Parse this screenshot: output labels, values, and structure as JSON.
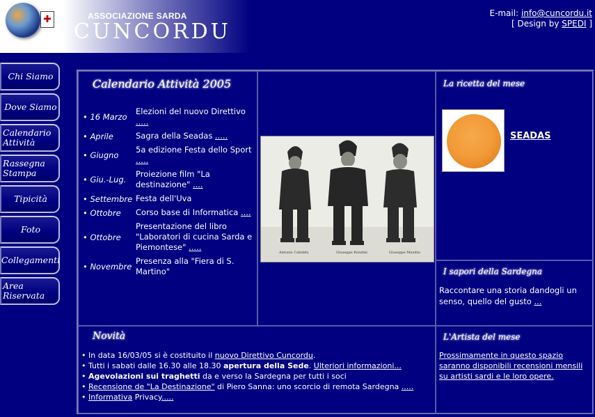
{
  "header": {
    "association": "ASSOCIAZIONE SARDA",
    "brand": "CUNCORDU",
    "email_label": "E-mail:",
    "email": "info@cuncordu.it",
    "design_prefix": "[ Design by",
    "design_link": "SPEDI",
    "design_suffix": "]"
  },
  "nav": {
    "items": [
      {
        "label": "Chi Siamo"
      },
      {
        "label": "Dove Siamo"
      },
      {
        "label": "Calendario Attività"
      },
      {
        "label": "Rassegna Stampa"
      },
      {
        "label": "Tipicità"
      },
      {
        "label": "Foto"
      },
      {
        "label": "Collegamenti"
      },
      {
        "label": "Area Riservata"
      }
    ]
  },
  "calendario": {
    "title": "Calendario Attività  2005",
    "events": [
      {
        "date": "• 16 Marzo",
        "text": "Elezioni del nuovo Direttivo",
        "more": "....."
      },
      {
        "date": "• Aprile",
        "text": "Sagra della Seadas",
        "more": "....."
      },
      {
        "date": "• Giugno",
        "text": "5a edizione Festa dello Sport",
        "more": "....."
      },
      {
        "date": "• Giu.-Lug.",
        "text": "Proiezione film \"La destinazione\"",
        "more": "...."
      },
      {
        "date": "• Settembre",
        "text": "Festa dell'Uva",
        "more": ""
      },
      {
        "date": "• Ottobre",
        "text": "Corso base di Informatica",
        "more": "...."
      },
      {
        "date": "• Ottobre",
        "text": "Presentazione del libro \"Laboratori di cucina Sarda e Piemontese\"",
        "more": "....."
      },
      {
        "date": "• Novembre",
        "text": "Presenza alla \"Fiera di S. Martino\"",
        "more": ""
      }
    ]
  },
  "photo": {
    "captions": [
      "Antonio Cabiddu",
      "Giuseppe Rondini",
      "Giuseppe Musittu"
    ]
  },
  "ricetta": {
    "title": "La ricetta del mese",
    "dish": "SEADAS"
  },
  "sapori": {
    "title": "I sapori della Sardegna",
    "text": "Raccontare una storia dandogli un senso, quello del gusto",
    "more": "..."
  },
  "novita": {
    "title": "Novità",
    "items": {
      "item1_pre": "• In data 16/03/05 si è costituito il ",
      "item1_link": "nuovo Direttivo Cuncordu",
      "item1_post": ".",
      "item2_pre": "• Tutti i sabati dalle 16.30 alle 18.30 ",
      "item2_bold": "apertura della Sede",
      "item2_mid": ". ",
      "item2_link": "Ulteriori informazioni...",
      "item3_pre": "• ",
      "item3_bold": "Agevolazioni sui traghetti",
      "item3_post": " da e verso la Sardegna per tutti i soci",
      "item4_pre": "• ",
      "item4_link": "Recensione de \"La Destinazione\"",
      "item4_post": " di Piero Sanna: uno scorcio di remota Sardegna ",
      "item4_more": ".....",
      "item5_pre": "• ",
      "item5_link": "Informativa",
      "item5_mid": " Privacy",
      "item5_more": "....."
    }
  },
  "artista": {
    "title": "L'Artista del mese",
    "text": "Prossimamente in questo spazio saranno disponibili recensioni mensili su artisti sardi e le loro opere."
  }
}
